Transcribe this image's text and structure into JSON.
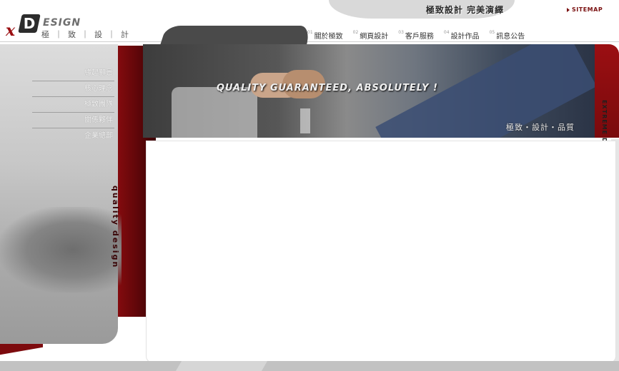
{
  "header": {
    "logo": {
      "x": "x",
      "d": "D",
      "esign": "ESIGN",
      "subtitle": "極 ｜ 致 ｜ 設 ｜ 計"
    },
    "slogan": "極致設計 完美演繹",
    "sitemap_label": "SITEMAP"
  },
  "nav": {
    "items": [
      {
        "num": "01",
        "label": "關於極致"
      },
      {
        "num": "02",
        "label": "網頁設計"
      },
      {
        "num": "03",
        "label": "客戶服務"
      },
      {
        "num": "04",
        "label": "設計作品"
      },
      {
        "num": "05",
        "label": "訊息公告"
      }
    ]
  },
  "sidebar": {
    "items": [
      {
        "label": "緣起願景"
      },
      {
        "label": "核心理念"
      },
      {
        "label": "極致團隊"
      },
      {
        "label": "關係夥伴"
      },
      {
        "label": "企業總部"
      }
    ],
    "vertical_text": "quality design"
  },
  "banner": {
    "tagline": "QUALITY GUARANTEED, ABSOLUTELY !",
    "subtitle": "極致・設計・品質",
    "side_text": "EXTREME DESIGN FOR YOUR WEB PAGE"
  },
  "colors": {
    "brand_red": "#9b0f12",
    "dark_red": "#5c0609",
    "gray": "#c7c7c7"
  }
}
